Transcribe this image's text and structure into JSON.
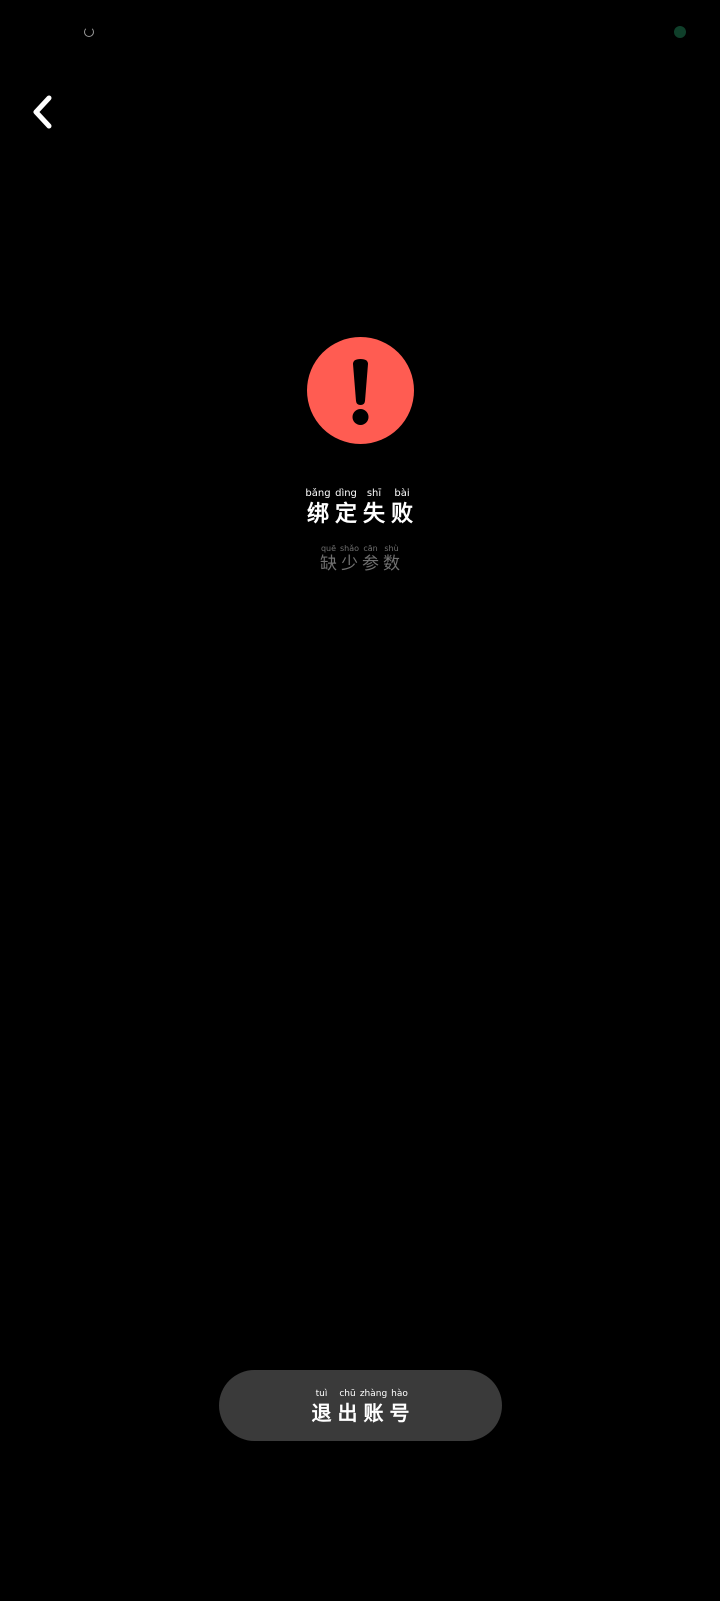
{
  "colors": {
    "background": "#000000",
    "error_accent": "#ff5c52",
    "button_bg": "#3a3a3a",
    "text_primary": "#ffffff",
    "text_secondary": "#707070"
  },
  "header": {
    "back_icon": "chevron-left-icon"
  },
  "status": {
    "title_chars": [
      {
        "pinyin": "bǎng",
        "hanzi": "绑"
      },
      {
        "pinyin": "dìng",
        "hanzi": "定"
      },
      {
        "pinyin": "shī",
        "hanzi": "失"
      },
      {
        "pinyin": "bài",
        "hanzi": "败"
      }
    ],
    "message_chars": [
      {
        "pinyin": "quē",
        "hanzi": "缺"
      },
      {
        "pinyin": "shǎo",
        "hanzi": "少"
      },
      {
        "pinyin": "cān",
        "hanzi": "参"
      },
      {
        "pinyin": "shù",
        "hanzi": "数"
      }
    ],
    "icon": "exclamation-circle-icon"
  },
  "actions": {
    "logout_chars": [
      {
        "pinyin": "tuì",
        "hanzi": "退"
      },
      {
        "pinyin": "chū",
        "hanzi": "出"
      },
      {
        "pinyin": "zhàng",
        "hanzi": "账"
      },
      {
        "pinyin": "hào",
        "hanzi": "号"
      }
    ]
  }
}
